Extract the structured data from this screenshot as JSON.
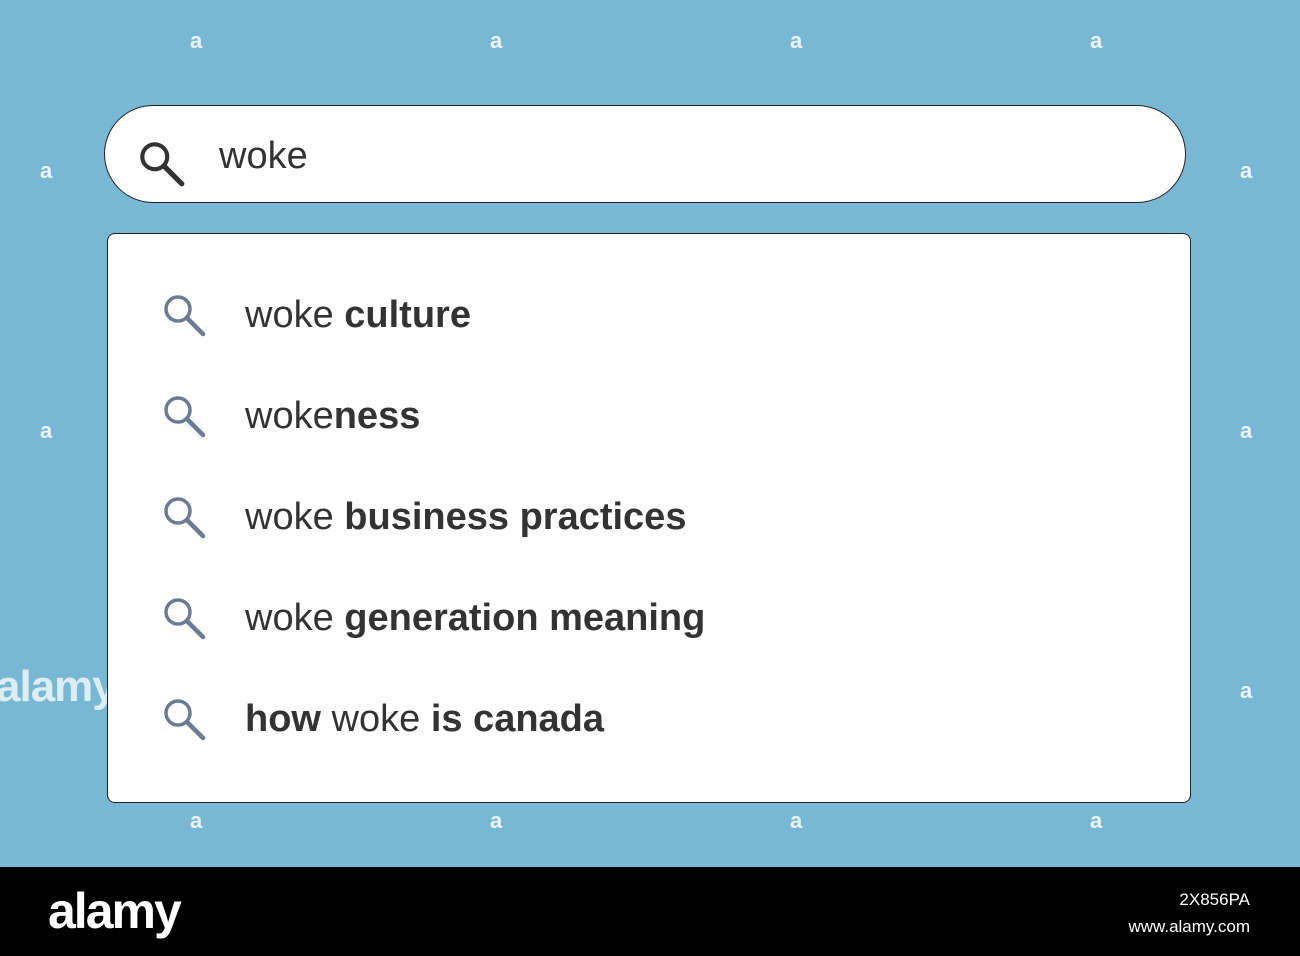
{
  "colors": {
    "background": "#79b8d4",
    "panel": "#ffffff",
    "border": "#222222",
    "text": "#333333",
    "suggestion_icon": "#6a7b96",
    "search_icon": "#333333",
    "footer": "#000000"
  },
  "search": {
    "icon": "search-icon",
    "query": "woke"
  },
  "suggestions": [
    {
      "icon": "search-icon",
      "parts": [
        {
          "text": "woke ",
          "bold": false
        },
        {
          "text": "culture",
          "bold": true
        }
      ]
    },
    {
      "icon": "search-icon",
      "parts": [
        {
          "text": "woke",
          "bold": false
        },
        {
          "text": "ness",
          "bold": true
        }
      ]
    },
    {
      "icon": "search-icon",
      "parts": [
        {
          "text": "woke ",
          "bold": false
        },
        {
          "text": "business practices",
          "bold": true
        }
      ]
    },
    {
      "icon": "search-icon",
      "parts": [
        {
          "text": "woke ",
          "bold": false
        },
        {
          "text": "generation meaning",
          "bold": true
        }
      ]
    },
    {
      "icon": "search-icon",
      "parts": [
        {
          "text": "how",
          "bold": true
        },
        {
          "text": " woke ",
          "bold": false
        },
        {
          "text": "is canada",
          "bold": true
        }
      ]
    }
  ],
  "watermark": {
    "mark": "a",
    "side_text": "alamy"
  },
  "footer": {
    "logo": "alamy",
    "image_id": "2X856PA",
    "site": "www.alamy.com"
  }
}
